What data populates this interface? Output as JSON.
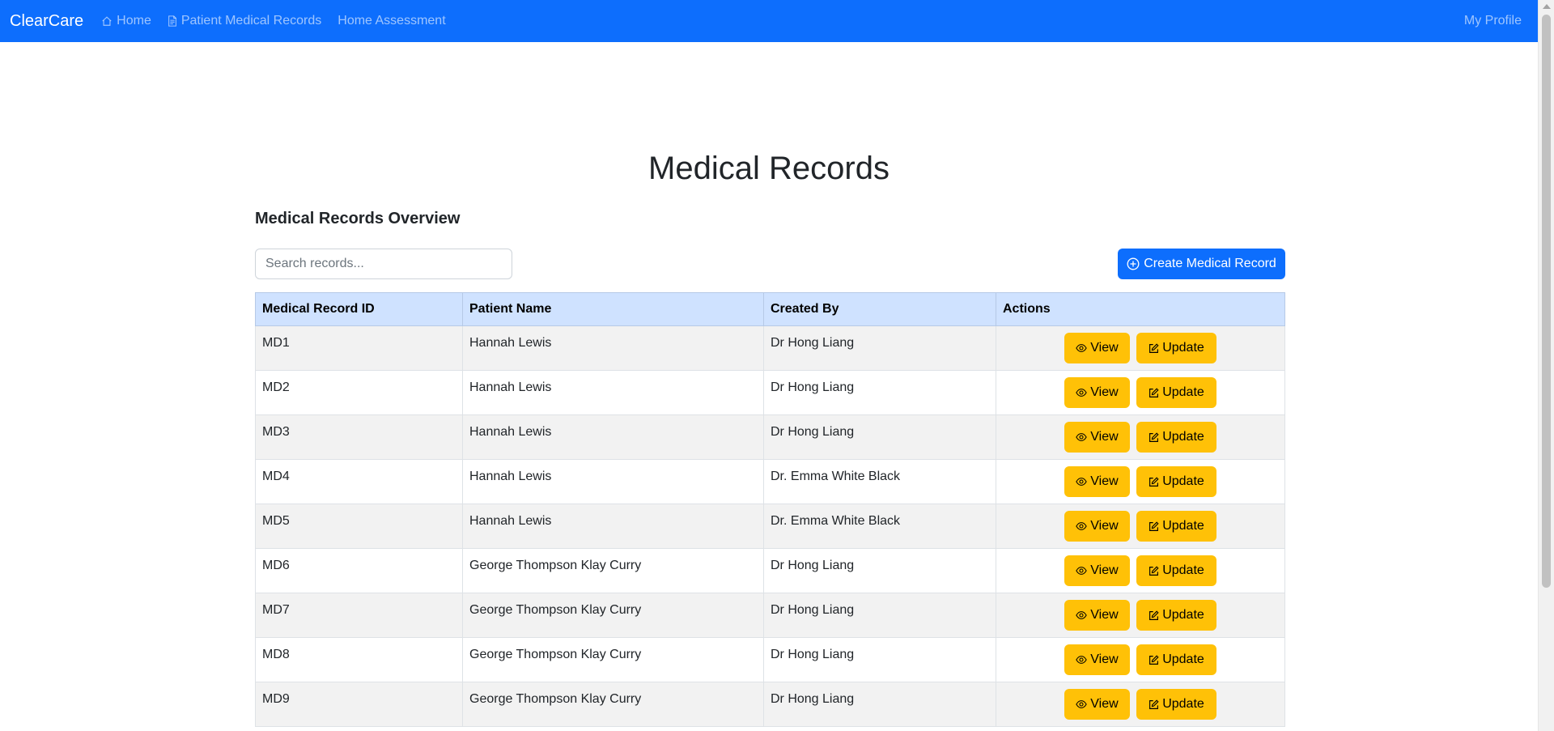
{
  "navbar": {
    "brand": "ClearCare",
    "links": [
      {
        "label": "Home",
        "icon": "house-icon"
      },
      {
        "label": "Patient Medical Records",
        "icon": "file-text-icon"
      },
      {
        "label": "Home Assessment",
        "icon": ""
      }
    ],
    "profile": "My Profile"
  },
  "main": {
    "title": "Medical Records",
    "subtitle": "Medical Records Overview",
    "search": {
      "placeholder": "Search records...",
      "value": ""
    },
    "create_button": "Create Medical Record"
  },
  "table": {
    "headers": [
      "Medical Record ID",
      "Patient Name",
      "Created By",
      "Actions"
    ],
    "view_label": "View",
    "update_label": "Update",
    "rows": [
      {
        "id": "MD1",
        "patient": "Hannah Lewis",
        "created_by": "Dr Hong Liang"
      },
      {
        "id": "MD2",
        "patient": "Hannah Lewis",
        "created_by": "Dr Hong Liang"
      },
      {
        "id": "MD3",
        "patient": "Hannah Lewis",
        "created_by": "Dr Hong Liang"
      },
      {
        "id": "MD4",
        "patient": "Hannah Lewis",
        "created_by": "Dr. Emma White Black"
      },
      {
        "id": "MD5",
        "patient": "Hannah Lewis",
        "created_by": "Dr. Emma White Black"
      },
      {
        "id": "MD6",
        "patient": "George Thompson Klay Curry",
        "created_by": "Dr Hong Liang"
      },
      {
        "id": "MD7",
        "patient": "George Thompson Klay Curry",
        "created_by": "Dr Hong Liang"
      },
      {
        "id": "MD8",
        "patient": "George Thompson Klay Curry",
        "created_by": "Dr Hong Liang"
      },
      {
        "id": "MD9",
        "patient": "George Thompson Klay Curry",
        "created_by": "Dr Hong Liang"
      }
    ]
  },
  "colors": {
    "primary": "#0d6efd",
    "warning": "#ffc107",
    "table_header": "#cfe2ff",
    "row_stripe": "#f2f2f2"
  }
}
